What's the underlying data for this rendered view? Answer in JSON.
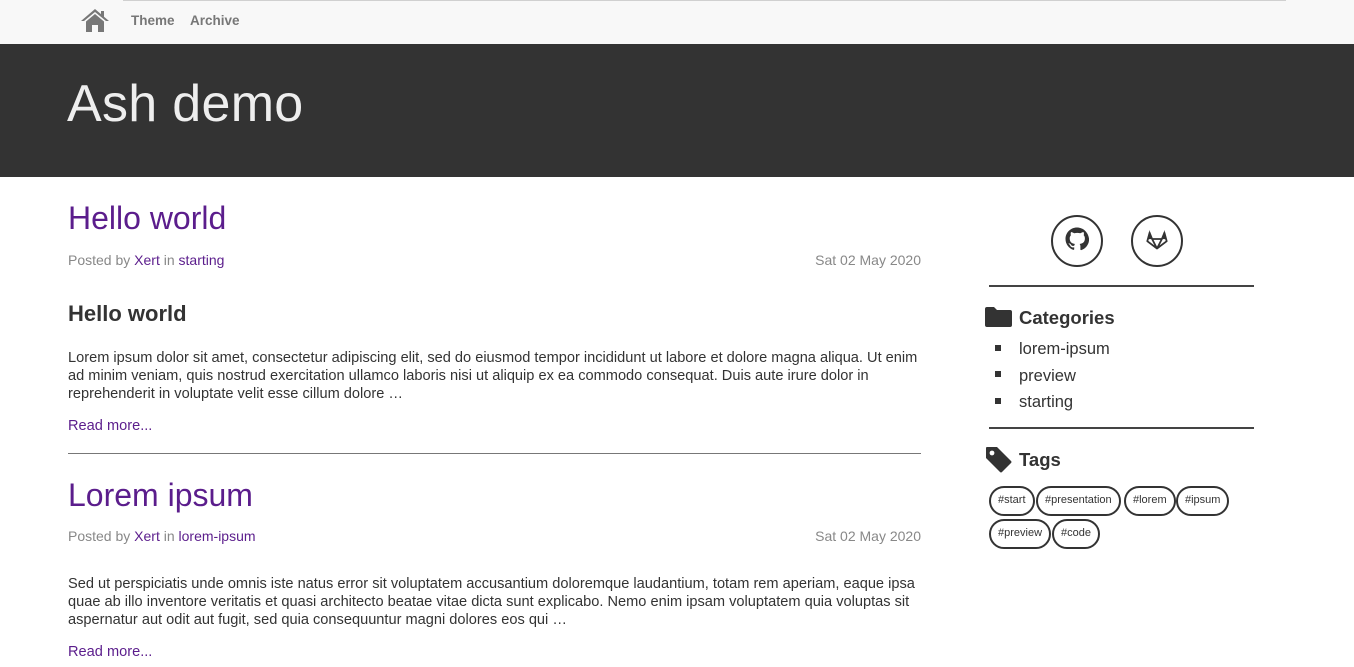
{
  "nav": {
    "home_icon": "home-icon",
    "links": [
      {
        "label": "Theme"
      },
      {
        "label": "Archive"
      }
    ]
  },
  "header": {
    "title": "Ash demo"
  },
  "posts": [
    {
      "title": "Hello world",
      "posted_by": "Posted by",
      "author": "Xert",
      "in_label": "in",
      "category": "starting",
      "date": "Sat 02 May 2020",
      "subheading": "Hello world",
      "excerpt": "Lorem ipsum dolor sit amet, consectetur adipiscing elit, sed do eiusmod tempor incididunt ut labore et dolore magna aliqua. Ut enim ad minim veniam, quis nostrud exercitation ullamco laboris nisi ut aliquip ex ea commodo consequat. Duis aute irure dolor in reprehenderit in voluptate velit esse cillum dolore …",
      "read_more": "Read more..."
    },
    {
      "title": "Lorem ipsum",
      "posted_by": "Posted by",
      "author": "Xert",
      "in_label": "in",
      "category": "lorem-ipsum",
      "date": "Sat 02 May 2020",
      "excerpt": "Sed ut perspiciatis unde omnis iste natus error sit voluptatem accusantium doloremque laudantium, totam rem aperiam, eaque ipsa quae ab illo inventore veritatis et quasi architecto beatae vitae dicta sunt explicabo. Nemo enim ipsam voluptatem quia voluptas sit aspernatur aut odit aut fugit, sed quia consequuntur magni dolores eos qui …",
      "read_more": "Read more..."
    }
  ],
  "sidebar": {
    "social": [
      {
        "icon": "github-icon"
      },
      {
        "icon": "gitlab-icon"
      }
    ],
    "categories_title": "Categories",
    "categories_icon": "folder-icon",
    "categories": [
      "lorem-ipsum",
      "preview",
      "starting"
    ],
    "tags_title": "Tags",
    "tags_icon": "tag-icon",
    "tags": [
      "#start",
      "#presentation",
      "#lorem",
      "#ipsum",
      "#preview",
      "#code"
    ]
  },
  "colors": {
    "link": "#5b1d8c",
    "banner": "#333333",
    "nav_bg": "#f8f8f8"
  }
}
